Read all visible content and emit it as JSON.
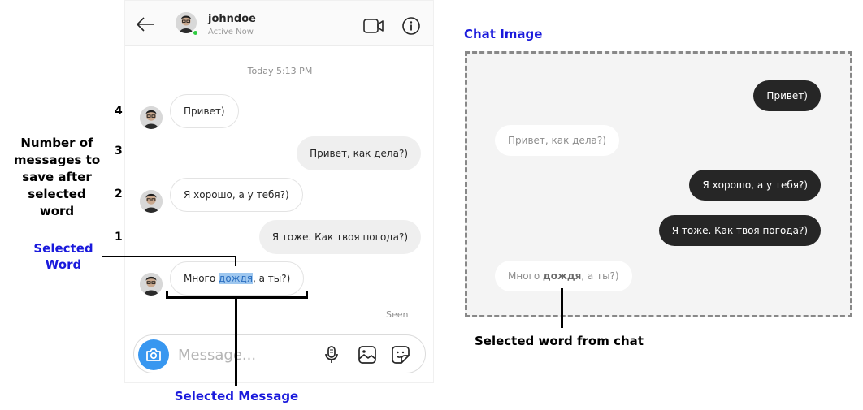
{
  "chat": {
    "username": "johndoe",
    "status": "Active Now",
    "timestamp": "Today 5:13 PM",
    "messages": [
      {
        "direction": "in",
        "text": "Привет)"
      },
      {
        "direction": "out",
        "text": "Привет, как дела?)"
      },
      {
        "direction": "in",
        "text": "Я хорошо, а у тебя?)"
      },
      {
        "direction": "out",
        "text": "Я тоже. Как твоя погода?)"
      },
      {
        "direction": "in",
        "before": "Много ",
        "highlight": "дождя",
        "after": ", а ты?)"
      }
    ],
    "seen": "Seen",
    "composer": {
      "placeholder": "Message..."
    }
  },
  "annotations": {
    "numbers": [
      "4",
      "3",
      "2",
      "1"
    ],
    "number_note": [
      "Number of",
      "messages to",
      "save after",
      "selected",
      "word"
    ],
    "selected_word": [
      "Selected",
      "Word"
    ],
    "selected_message": "Selected Message"
  },
  "chat_image": {
    "title": "Chat Image",
    "messages": [
      {
        "direction": "out",
        "text": "Привет)"
      },
      {
        "direction": "in",
        "text": "Привет, как дела?)"
      },
      {
        "direction": "out",
        "text": "Я хорошо, а у тебя?)"
      },
      {
        "direction": "out",
        "text": "Я тоже. Как твоя погода?)"
      },
      {
        "direction": "in",
        "before": "Много ",
        "bold": "дождя",
        "after": ", а ты?)"
      }
    ],
    "caption": "Selected word from chat"
  },
  "icons": [
    "back-arrow-icon",
    "video-call-icon",
    "info-icon",
    "camera-icon",
    "microphone-icon",
    "image-icon",
    "sticker-icon"
  ],
  "colors": {
    "accent_blue": "#3897f0",
    "annotation_blue": "#1a1adc",
    "highlight": "#9ec7ef",
    "online": "#2ecc40"
  }
}
